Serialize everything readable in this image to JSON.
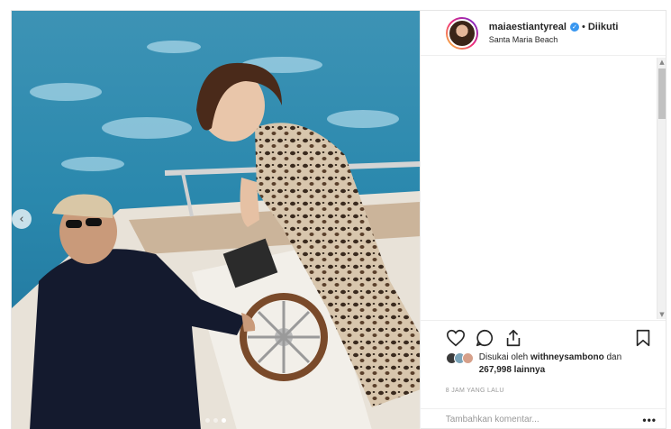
{
  "post": {
    "username": "maiaestiantyreal",
    "separator": "•",
    "follow_status": "Diikuti",
    "location": "Santa Maria Beach",
    "likes": {
      "prefix": "Disukai oleh ",
      "liked_by": "withneysambono",
      "middle": " dan ",
      "count": "267,998",
      "suffix": " lainnya"
    },
    "timestamp": "8 JAM YANG LALU",
    "comment_placeholder": "Tambahkan komentar...",
    "more_label": "•••",
    "carousel": {
      "total": 3,
      "active": 3
    }
  },
  "icons": {
    "like": "heart-icon",
    "comment": "comment-icon",
    "share": "share-icon",
    "save": "bookmark-icon",
    "verified": "verified-badge-icon",
    "carousel_prev": "chevron-left-icon"
  },
  "colors": {
    "verified_blue": "#3897f0",
    "sea": "#2a88ad",
    "text": "#262626",
    "muted": "#999999",
    "border": "#efefef"
  }
}
